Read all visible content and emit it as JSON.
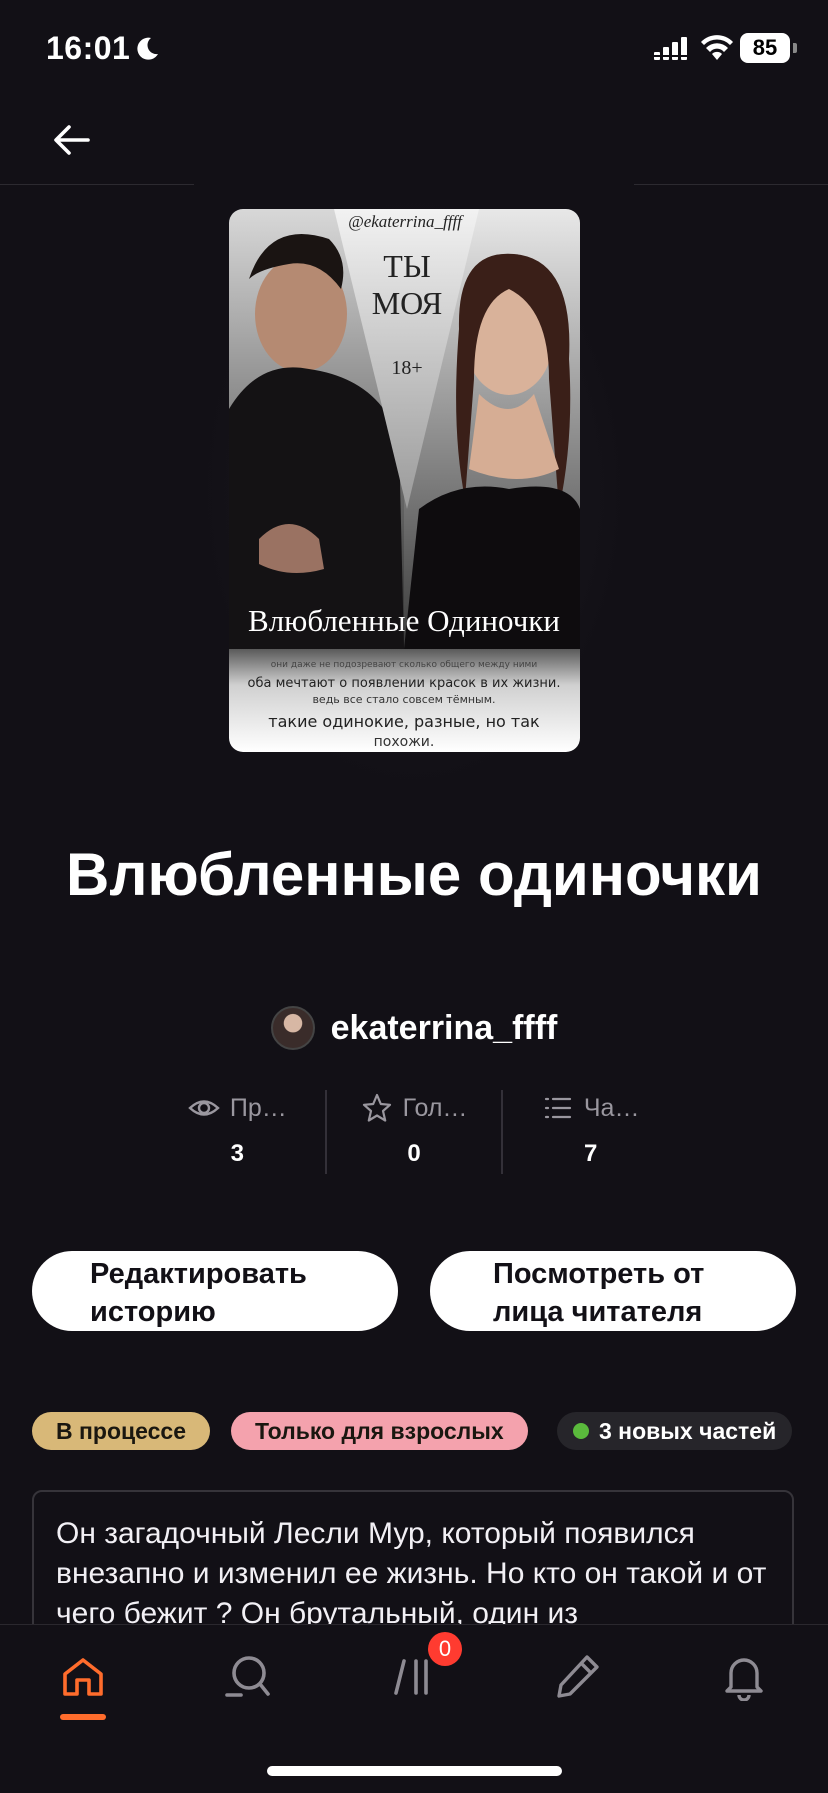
{
  "status_bar": {
    "time": "16:01",
    "battery": "85"
  },
  "story": {
    "title": "Влюбленные одиночки",
    "author": "ekaterrina_ffff",
    "cover": {
      "handle": "@ekaterrina_ffff",
      "top_text_1": "ТЫ",
      "top_text_2": "МОЯ",
      "age": "18+",
      "cover_title": "Влюбленные Одиночки",
      "line_1": "они даже не подозревают сколько общего между ними",
      "line_2": "оба мечтают о появлении красок в их жизни.",
      "line_3": "ведь все стало совсем тёмным.",
      "line_4": "такие одинокие, разные, но так",
      "line_5": "похожи."
    }
  },
  "stats": [
    {
      "icon": "eye-icon",
      "label": "Пр…",
      "value": "3"
    },
    {
      "icon": "star-icon",
      "label": "Гол…",
      "value": "0"
    },
    {
      "icon": "list-icon",
      "label": "Ча…",
      "value": "7"
    }
  ],
  "actions": {
    "edit_label": "Редактировать историю",
    "view_label": "Посмотреть от лица читателя"
  },
  "tags": {
    "progress": "В процессе",
    "adult": "Только для взрослых",
    "new_parts": "3 новых частей"
  },
  "description": "Он загадочный Лесли Мур, который появился внезапно и изменил ее жизнь. Но кто он такой и от чего бежит ? Он брутальный, один из",
  "nav": {
    "library_badge": "0"
  },
  "colors": {
    "background": "#121016",
    "accent": "#ff6c2c",
    "tag_progress": "#d8b878",
    "tag_adult": "#f4a2ad",
    "badge": "#ff3b30"
  }
}
